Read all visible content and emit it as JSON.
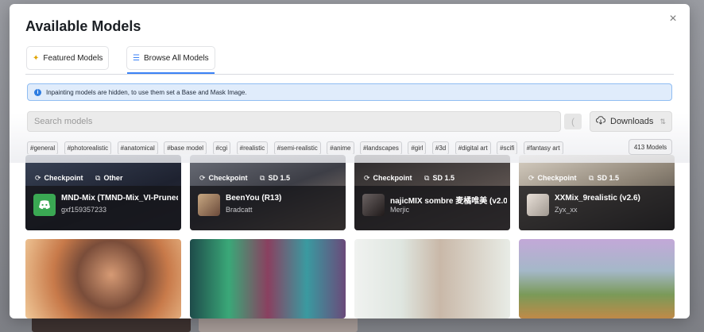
{
  "modal": {
    "title": "Available Models",
    "close_symbol": "×"
  },
  "tabs": [
    {
      "label": "Featured Models",
      "icon": "sparkle-icon",
      "active": false
    },
    {
      "label": "Browse All Models",
      "icon": "list-icon",
      "active": true
    }
  ],
  "notice": {
    "text": "Inpainting models are hidden, to use them set a Base and Mask Image."
  },
  "search": {
    "placeholder": "Search models",
    "value": ""
  },
  "downloads_label": "Downloads",
  "tags": [
    "#general",
    "#photorealistic",
    "#anatomical",
    "#base model",
    "#cgi",
    "#realistic",
    "#semi-realistic",
    "#anime",
    "#landscapes",
    "#girl",
    "#3d",
    "#digital art",
    "#scifi",
    "#fantasy art"
  ],
  "model_count": "413 Models",
  "models": [
    {
      "type": "Checkpoint",
      "base": "Other",
      "name": "MND-Mix (TMND-Mix_VI-Pruned)",
      "author": "gxf159357233"
    },
    {
      "type": "Checkpoint",
      "base": "SD 1.5",
      "name": "BeenYou (R13)",
      "author": "Bradcatt"
    },
    {
      "type": "Checkpoint",
      "base": "SD 1.5",
      "name": "najicMIX sombre 麦橘唯美 (v2.0)",
      "author": "Merjic"
    },
    {
      "type": "Checkpoint",
      "base": "SD 1.5",
      "name": "XXMix_9realistic (v2.6)",
      "author": "Zyx_xx"
    }
  ],
  "colors": {
    "accent": "#3b82f6",
    "notice_bg": "#e0ecfb",
    "notice_border": "#90bdf2"
  }
}
